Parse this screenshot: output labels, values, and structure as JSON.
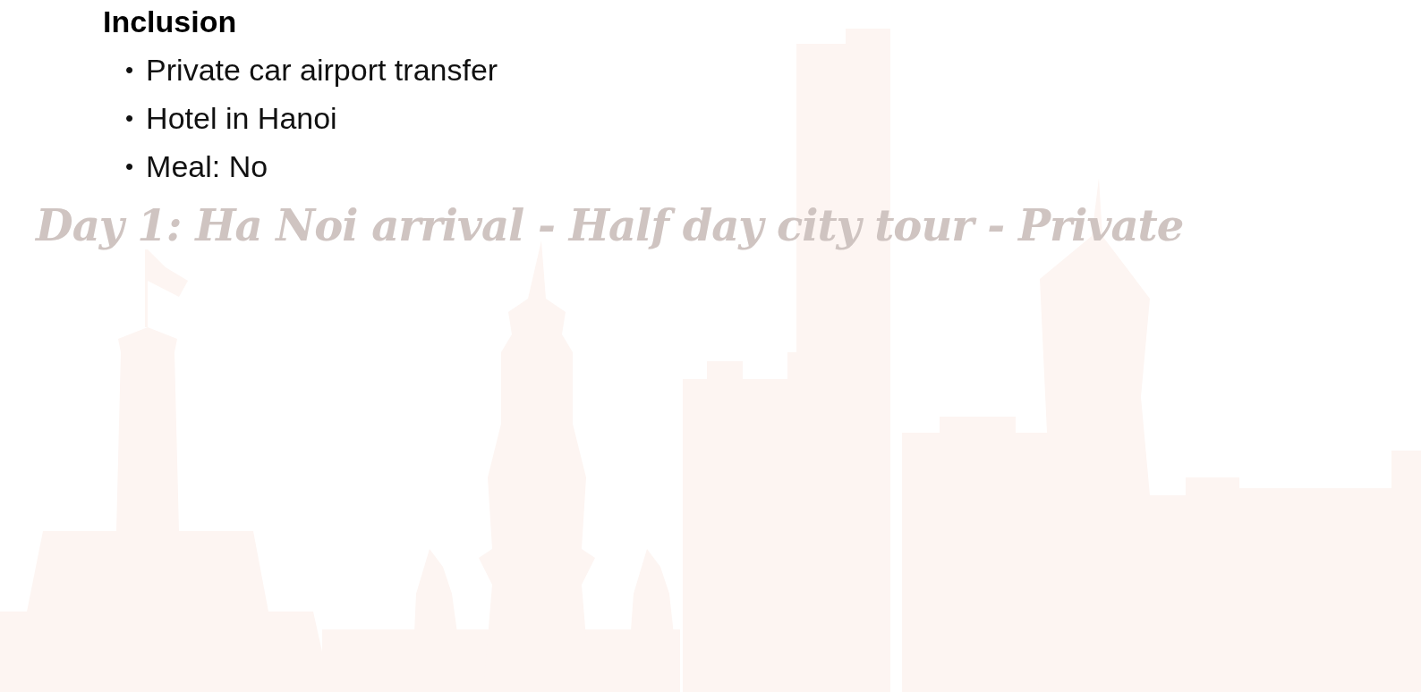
{
  "section": {
    "heading": "Inclusion",
    "items": [
      {
        "bullet": "•",
        "text": "Private car airport transfer"
      },
      {
        "bullet": "•",
        "text": "Hotel in Hanoi"
      },
      {
        "bullet": "•",
        "text": "Meal: No"
      }
    ]
  },
  "day_title": "Day 1: Ha Noi arrival - Half day city tour - Private"
}
